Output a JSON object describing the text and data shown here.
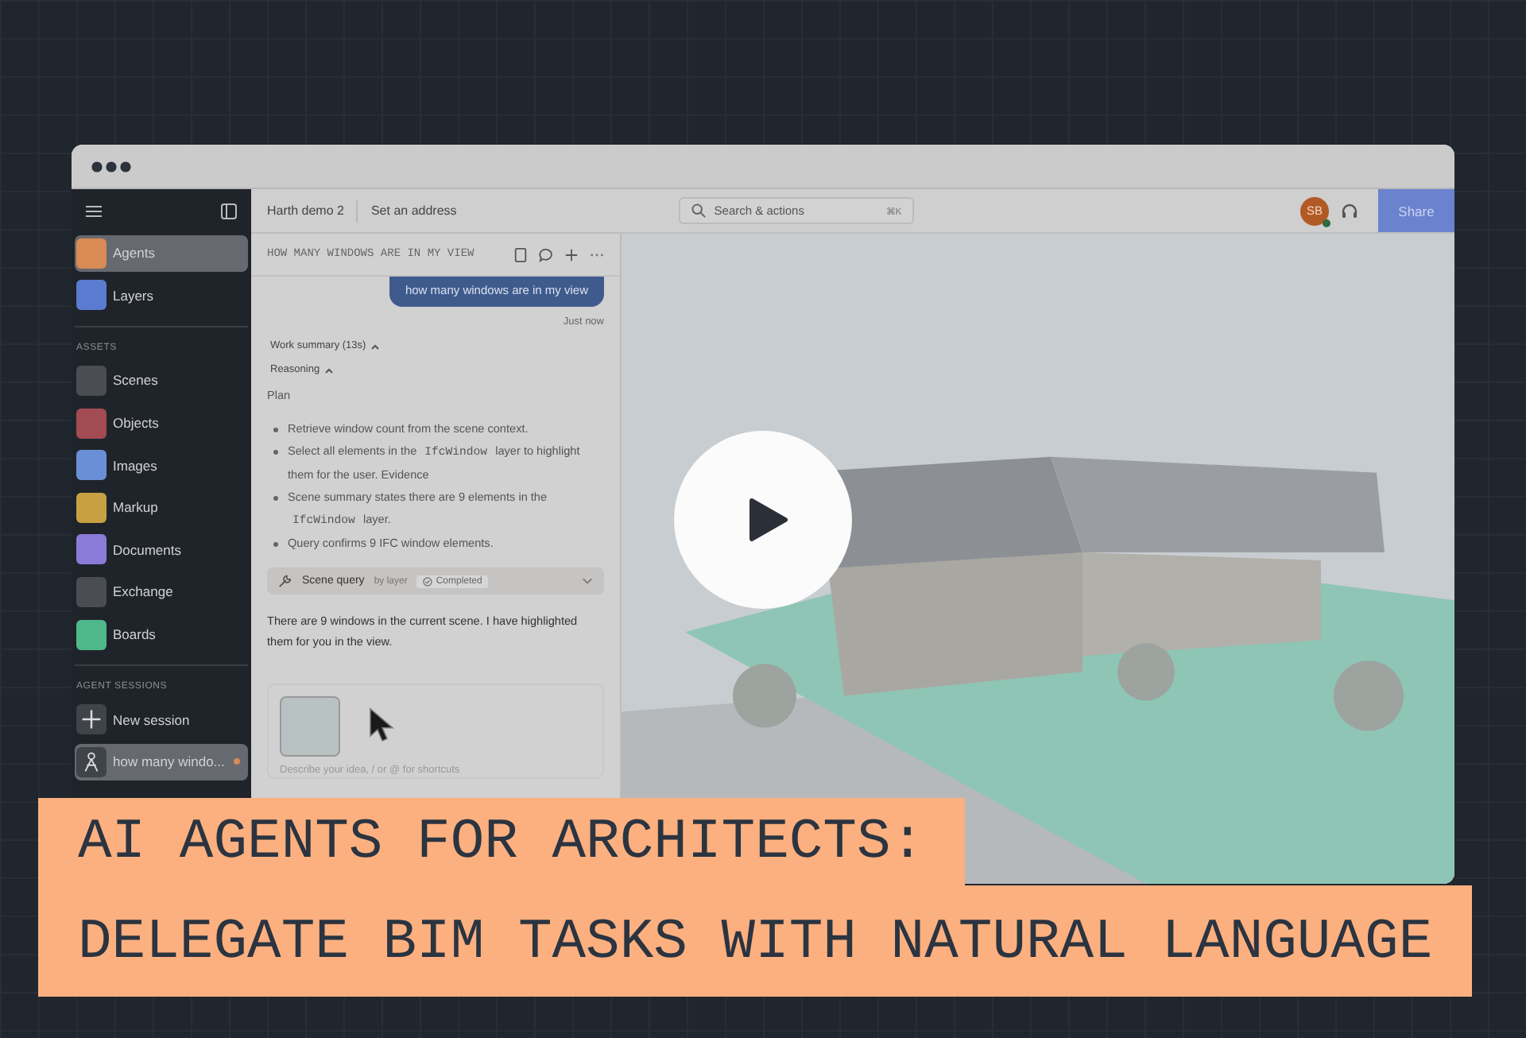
{
  "top_bar": {
    "project": "Harth demo 2",
    "address": "Set an address",
    "search_placeholder": "Search & actions",
    "shortcut": "⌘K",
    "avatar": "SB",
    "share": "Share"
  },
  "sidebar": {
    "nav": [
      {
        "label": "Agents",
        "selected": true,
        "color": "#d98a55"
      },
      {
        "label": "Layers",
        "selected": false,
        "color": "#5a7bcf"
      }
    ],
    "assets_heading": "ASSETS",
    "assets": [
      {
        "label": "Scenes",
        "color": "#4a4d52"
      },
      {
        "label": "Objects",
        "color": "#a24b52"
      },
      {
        "label": "Images",
        "color": "#6a8fd6"
      },
      {
        "label": "Markup",
        "color": "#c7a043"
      },
      {
        "label": "Documents",
        "color": "#8b7bd8"
      },
      {
        "label": "Exchange",
        "color": "#4a4d52"
      },
      {
        "label": "Boards",
        "color": "#4fb88a"
      }
    ],
    "sessions_heading": "AGENT SESSIONS",
    "sessions": [
      {
        "kind": "new",
        "label": "New session",
        "selected": false
      },
      {
        "kind": "session",
        "label": "how many windo...",
        "selected": true
      }
    ]
  },
  "chat": {
    "title": "HOW MANY WINDOWS ARE IN MY VIEW",
    "user_message": "how many windows are in my view",
    "timestamp": "Just now",
    "work_summary": "Work summary (13s)",
    "reasoning": "Reasoning",
    "plan_heading": "Plan",
    "plan_items": [
      {
        "parts": [
          {
            "kind": "text",
            "text": "Retrieve window count from the scene context."
          }
        ]
      },
      {
        "parts": [
          {
            "kind": "text",
            "text": "Select all elements in the "
          },
          {
            "kind": "code",
            "text": "IfcWindow"
          },
          {
            "kind": "text",
            "text": " layer to highlight them for the user. Evidence"
          }
        ]
      },
      {
        "parts": [
          {
            "kind": "text",
            "text": "Scene summary states there are 9 elements in the "
          },
          {
            "kind": "code",
            "text": "IfcWindow"
          },
          {
            "kind": "text",
            "text": " layer."
          }
        ]
      },
      {
        "parts": [
          {
            "kind": "text",
            "text": "Query confirms 9 IFC window elements."
          }
        ]
      }
    ],
    "tool": {
      "name": "Scene query",
      "by": "by layer",
      "status": "Completed"
    },
    "answer": "There are 9 windows in the current scene. I have highlighted them for you in the view.",
    "composer_placeholder": "Describe your idea, / or @ for shortcuts"
  },
  "banner": {
    "lines": [
      "AI AGENTS FOR ARCHITECTS:",
      "DELEGATE BIM TASKS WITH NATURAL LANGUAGE"
    ]
  }
}
